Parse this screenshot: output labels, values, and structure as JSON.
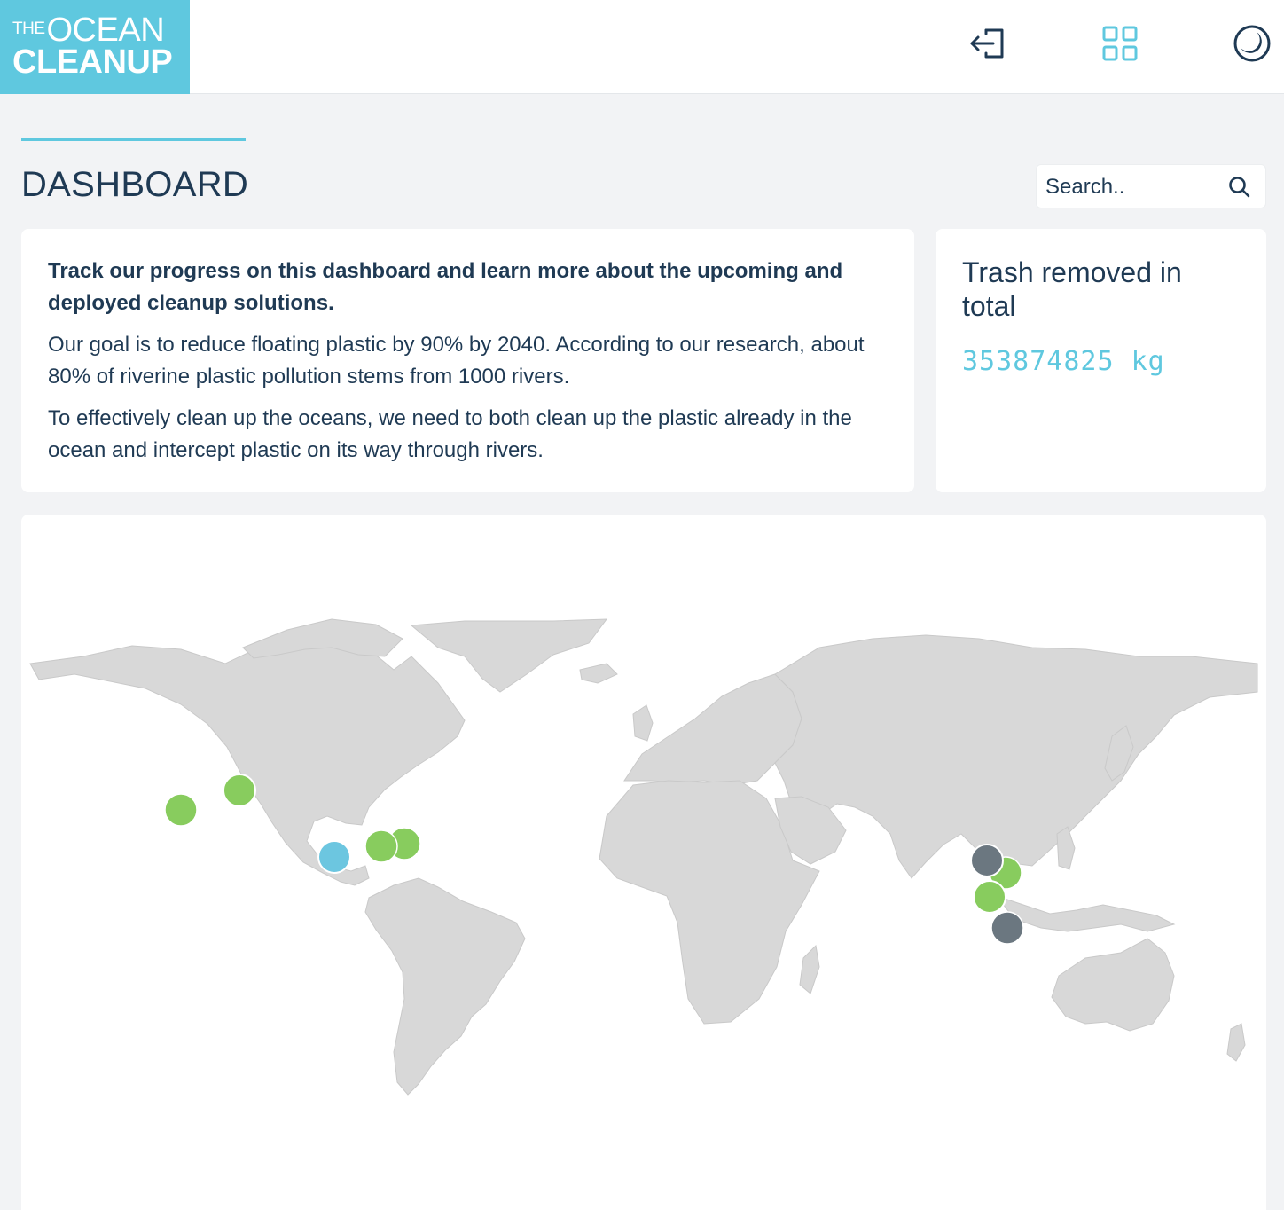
{
  "header": {
    "logo": {
      "the": "THE",
      "ocean": "OCEAN",
      "cleanup": "CLEANUP"
    },
    "icons": [
      "logout-icon",
      "grid-icon",
      "theme-toggle-icon"
    ],
    "colors": {
      "brand": "#5fc8df",
      "text": "#1f3a54"
    }
  },
  "page": {
    "title": "DASHBOARD"
  },
  "search": {
    "placeholder": "Search.."
  },
  "intro": {
    "lead": "Track our progress on this dashboard and learn more about the upcoming and deployed cleanup solutions.",
    "p1": "Our goal is to reduce floating plastic by 90% by 2040. According to our research, about 80% of riverine plastic pollution stems from 1000 rivers.",
    "p2": "To effectively clean up the oceans, we need to both clean up the plastic already in the ocean and intercept plastic on its way through rivers."
  },
  "stats": {
    "label": "Trash removed in total",
    "value": "353874825 kg"
  },
  "map": {
    "marker_colors": {
      "green": "#88cc5e",
      "blue": "#6cc6e0",
      "gray": "#6b7780"
    }
  }
}
